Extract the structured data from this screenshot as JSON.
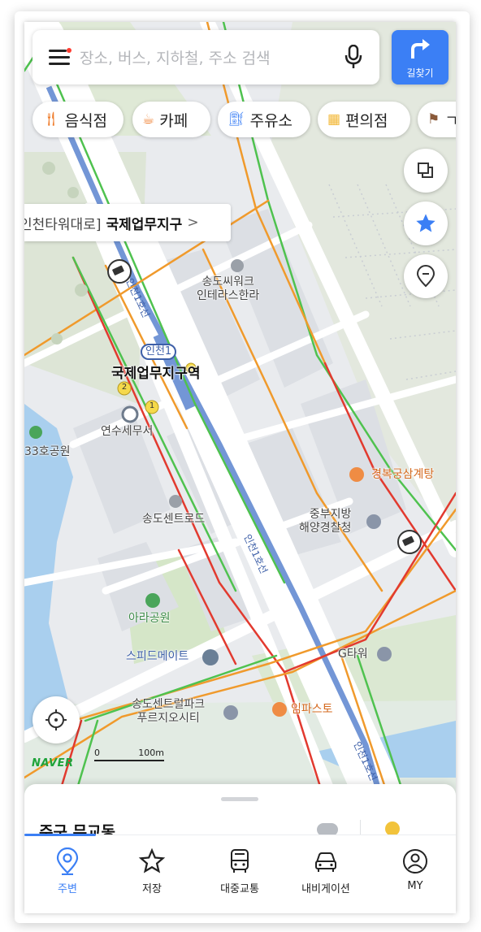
{
  "search": {
    "placeholder": "장소, 버스, 지하철, 주소 검색"
  },
  "directions_label": "길찾기",
  "categories": [
    {
      "label": "음식점",
      "icon": "fork-knife-icon"
    },
    {
      "label": "카페",
      "icon": "coffee-cup-icon"
    },
    {
      "label": "주유소",
      "icon": "gas-pump-icon"
    },
    {
      "label": "편의점",
      "icon": "store-icon"
    },
    {
      "label": "ㄱ",
      "icon": "flag-icon"
    }
  ],
  "location_banner": {
    "road": "인천타워대로]",
    "area": "국제업무지구",
    "chevron": ">"
  },
  "map": {
    "station_badge": "인천1",
    "station_name": "국제업무지구역",
    "exit_1": "1",
    "exit_2": "2",
    "line_label": "인천1호선",
    "line_label_2": "인천1호선",
    "line_label_3": "인천1호선",
    "pois": {
      "songdo_seawalk": "송도씨워크\n인테라스한라",
      "tax_office": "연수세무서",
      "park_33": "33호공원",
      "central_road": "송도센트로드",
      "gyeongbok": "경복궁삼계탕",
      "coast_guard": "중부지방\n해양경찰청",
      "ara_park": "아라공원",
      "speedmate": "스피드메이트",
      "g_tower": "G타워",
      "central_park": "송도센트럴파크\n푸르지오시티",
      "impasto": "임파스토"
    },
    "brand": "NAVER",
    "scale_zero": "0",
    "scale_label": "100m"
  },
  "sheet": {
    "title": "주구 무교동"
  },
  "tabs": [
    {
      "label": "주변",
      "icon": "location-pin-icon",
      "active": true
    },
    {
      "label": "저장",
      "icon": "star-outline-icon",
      "active": false
    },
    {
      "label": "대중교통",
      "icon": "bus-icon",
      "active": false
    },
    {
      "label": "내비게이션",
      "icon": "car-icon",
      "active": false
    },
    {
      "label": "MY",
      "icon": "profile-icon",
      "active": false
    }
  ],
  "colors": {
    "accent": "#3b7ff5",
    "traffic_orange": "#f09a2c",
    "traffic_red": "#e23a2f",
    "traffic_green": "#4fc24f",
    "subway_line": "#7396d6"
  }
}
